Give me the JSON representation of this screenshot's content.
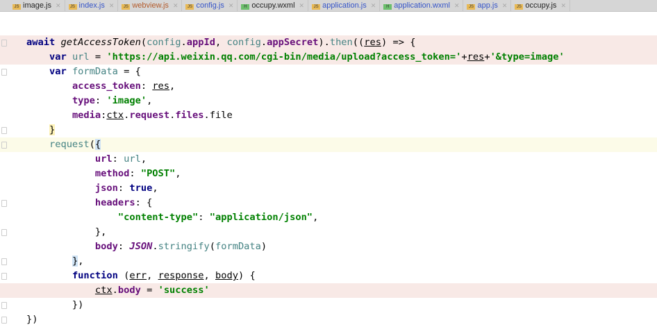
{
  "tabs": [
    {
      "label": "image.js",
      "type": "JS",
      "color": "black"
    },
    {
      "label": "index.js",
      "type": "JS",
      "color": "blue"
    },
    {
      "label": "webview.js",
      "type": "JS",
      "color": "brown"
    },
    {
      "label": "config.js",
      "type": "JS",
      "color": "blue"
    },
    {
      "label": "occupy.wxml",
      "type": "H",
      "color": "black"
    },
    {
      "label": "application.js",
      "type": "JS",
      "color": "blue"
    },
    {
      "label": "application.wxml",
      "type": "H",
      "color": "blue"
    },
    {
      "label": "app.js",
      "type": "JS",
      "color": "blue"
    },
    {
      "label": "occupy.js",
      "type": "JS",
      "color": "black"
    }
  ],
  "code": [
    {
      "bg": "err",
      "t": [
        [
          "kw",
          "await "
        ],
        [
          "fn",
          "getAccessToken"
        ],
        [
          "pl",
          "("
        ],
        [
          "lv",
          "config"
        ],
        [
          "pl",
          "."
        ],
        [
          "pr",
          "appId"
        ],
        [
          "pl",
          ", "
        ],
        [
          "lv",
          "config"
        ],
        [
          "pl",
          "."
        ],
        [
          "pr",
          "appSecret"
        ],
        [
          "pl",
          ")."
        ],
        [
          "lv",
          "then"
        ],
        [
          "pl",
          "(("
        ],
        [
          "ul",
          "res"
        ],
        [
          "pl",
          ") => {"
        ]
      ]
    },
    {
      "bg": "err",
      "t": [
        [
          "pl",
          "    "
        ],
        [
          "kw",
          "var "
        ],
        [
          "lv",
          "url"
        ],
        [
          "pl",
          " = "
        ],
        [
          "st",
          "'https://api.weixin.qq.com/cgi-bin/media/upload?access_token='"
        ],
        [
          "pl",
          "+"
        ],
        [
          "ul",
          "res"
        ],
        [
          "pl",
          "+"
        ],
        [
          "st",
          "'&type=image'"
        ]
      ]
    },
    {
      "t": [
        [
          "pl",
          "    "
        ],
        [
          "kw",
          "var "
        ],
        [
          "lv",
          "formData"
        ],
        [
          "pl",
          " = {"
        ]
      ]
    },
    {
      "t": [
        [
          "pl",
          "        "
        ],
        [
          "pr",
          "access_token"
        ],
        [
          "pl",
          ": "
        ],
        [
          "ul",
          "res"
        ],
        [
          "pl",
          ","
        ]
      ]
    },
    {
      "t": [
        [
          "pl",
          "        "
        ],
        [
          "pr",
          "type"
        ],
        [
          "pl",
          ": "
        ],
        [
          "st",
          "'image'"
        ],
        [
          "pl",
          ","
        ]
      ]
    },
    {
      "t": [
        [
          "pl",
          "        "
        ],
        [
          "pr",
          "media"
        ],
        [
          "pl",
          ":"
        ],
        [
          "ul",
          "ctx"
        ],
        [
          "pl",
          "."
        ],
        [
          "pr",
          "request"
        ],
        [
          "pl",
          "."
        ],
        [
          "pr",
          "files"
        ],
        [
          "pl",
          ".file"
        ]
      ]
    },
    {
      "t": [
        [
          "pl",
          "    "
        ],
        [
          "by",
          "}"
        ]
      ]
    },
    {
      "bg": "caret",
      "t": [
        [
          "pl",
          "    "
        ],
        [
          "lv",
          "request"
        ],
        [
          "pl",
          "("
        ],
        [
          "br",
          "{"
        ]
      ]
    },
    {
      "t": [
        [
          "pl",
          "            "
        ],
        [
          "pr",
          "url"
        ],
        [
          "pl",
          ": "
        ],
        [
          "lv",
          "url"
        ],
        [
          "pl",
          ","
        ]
      ]
    },
    {
      "t": [
        [
          "pl",
          "            "
        ],
        [
          "pr",
          "method"
        ],
        [
          "pl",
          ": "
        ],
        [
          "st",
          "\"POST\""
        ],
        [
          "pl",
          ","
        ]
      ]
    },
    {
      "t": [
        [
          "pl",
          "            "
        ],
        [
          "pr",
          "json"
        ],
        [
          "pl",
          ": "
        ],
        [
          "kw",
          "true"
        ],
        [
          "pl",
          ","
        ]
      ]
    },
    {
      "t": [
        [
          "pl",
          "            "
        ],
        [
          "pr",
          "headers"
        ],
        [
          "pl",
          ": {"
        ]
      ]
    },
    {
      "t": [
        [
          "pl",
          "                "
        ],
        [
          "st",
          "\"content-type\""
        ],
        [
          "pl",
          ": "
        ],
        [
          "st",
          "\"application/json\""
        ],
        [
          "pl",
          ","
        ]
      ]
    },
    {
      "t": [
        [
          "pl",
          "            },"
        ]
      ]
    },
    {
      "t": [
        [
          "pl",
          "            "
        ],
        [
          "pr",
          "body"
        ],
        [
          "pl",
          ": "
        ],
        [
          "gl",
          "JSON"
        ],
        [
          "pl",
          "."
        ],
        [
          "lv",
          "stringify"
        ],
        [
          "pl",
          "("
        ],
        [
          "lv",
          "formData"
        ],
        [
          "pl",
          ")"
        ]
      ]
    },
    {
      "t": [
        [
          "pl",
          "        "
        ],
        [
          "br",
          "}"
        ],
        [
          "pl",
          ","
        ]
      ]
    },
    {
      "t": [
        [
          "pl",
          "        "
        ],
        [
          "kw",
          "function "
        ],
        [
          "pl",
          "("
        ],
        [
          "ul",
          "err"
        ],
        [
          "pl",
          ", "
        ],
        [
          "ul",
          "response"
        ],
        [
          "pl",
          ", "
        ],
        [
          "ul",
          "body"
        ],
        [
          "pl",
          ") {"
        ]
      ]
    },
    {
      "bg": "err",
      "t": [
        [
          "pl",
          "            "
        ],
        [
          "ul",
          "ctx"
        ],
        [
          "pl",
          "."
        ],
        [
          "pr",
          "body"
        ],
        [
          "pl",
          " = "
        ],
        [
          "st",
          "'success'"
        ]
      ]
    },
    {
      "t": [
        [
          "pl",
          "        })"
        ]
      ]
    },
    {
      "t": [
        [
          "pl",
          "})"
        ]
      ]
    }
  ]
}
